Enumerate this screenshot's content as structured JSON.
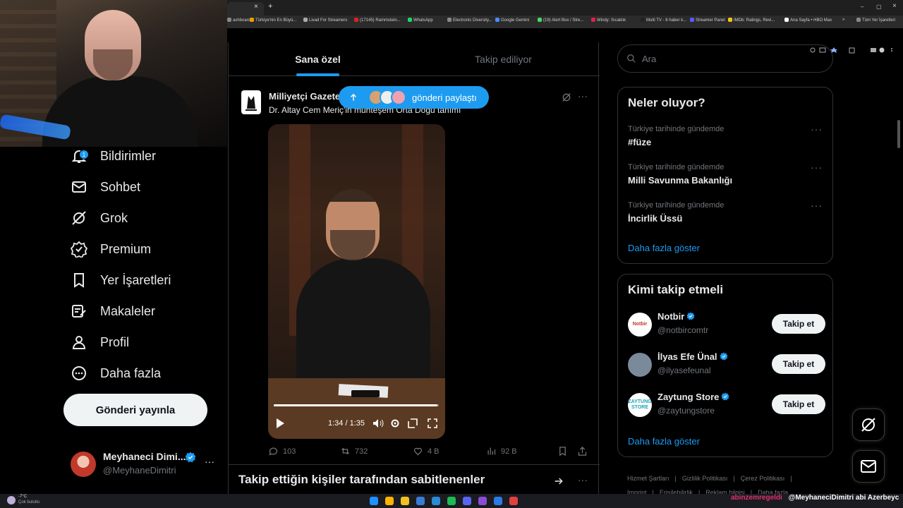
{
  "browser": {
    "bookmarks": [
      {
        "label": "ashboard",
        "color": "#888"
      },
      {
        "label": "Türkiye'nin En Büyü...",
        "color": "#e5a000"
      },
      {
        "label": "Livad For Streamers",
        "color": "#aaa"
      },
      {
        "label": "(17145) Rammstein...",
        "color": "#e02020"
      },
      {
        "label": "WhatsApp",
        "color": "#25d366"
      },
      {
        "label": "Electronic Diversity...",
        "color": "#888"
      },
      {
        "label": "Google Gemini",
        "color": "#4a8cff"
      },
      {
        "label": "(19) Alert Box / Stre...",
        "color": "#4cd964"
      },
      {
        "label": "Windy: Sıcaklık",
        "color": "#e02050"
      },
      {
        "label": "Multi TV - 6 haber k...",
        "color": "#222"
      },
      {
        "label": "Streamer Panel",
        "color": "#5a5aff"
      },
      {
        "label": "IMDb: Ratings, Revi...",
        "color": "#f5c518"
      },
      {
        "label": "Ana Sayfa • HBO Max",
        "color": "#fff"
      },
      {
        "label": "»",
        "color": ""
      },
      {
        "label": "Tüm Yer İşaretleri",
        "color": "#888"
      }
    ],
    "tab_close": "×",
    "new_tab": "+",
    "win_min": "–",
    "win_max": "▢",
    "win_close": "×"
  },
  "sidebar": {
    "notif_badge": "1",
    "items": [
      {
        "label": "Bildirimler",
        "icon": "bell-icon"
      },
      {
        "label": "Sohbet",
        "icon": "mail-icon"
      },
      {
        "label": "Grok",
        "icon": "grok-icon"
      },
      {
        "label": "Premium",
        "icon": "premium-icon"
      },
      {
        "label": "Yer İşaretleri",
        "icon": "bookmark-icon"
      },
      {
        "label": "Makaleler",
        "icon": "article-icon"
      },
      {
        "label": "Profil",
        "icon": "person-icon"
      },
      {
        "label": "Daha fazla",
        "icon": "more-circle-icon"
      }
    ],
    "post_button": "Gönderi yayınla",
    "profile": {
      "name": "Meyhaneci Dimi...",
      "handle": "@MeyhaneDimitri",
      "more": "···"
    }
  },
  "feed": {
    "tabs": [
      "Sana özel",
      "Takip ediliyor"
    ],
    "new_posts_pill": "gönderi paylaştı",
    "post": {
      "author": "Milliyetçi Gazete",
      "text": "Dr. Altay Cem Meriç'in muhteşem Orta Doğu tanımı",
      "video_time": "1:34 / 1:35",
      "video_progress": 0.99,
      "more": "···",
      "replies": "103",
      "reposts": "732",
      "likes": "4 B",
      "views": "92 B"
    },
    "pinned_section": "Takip ettiğin kişiler tarafından sabitlenenler",
    "pinned_more": "···"
  },
  "right": {
    "search_placeholder": "Ara",
    "trends_title": "Neler oluyor?",
    "trends": [
      {
        "context": "Türkiye tarihinde gündemde",
        "name": "#füze"
      },
      {
        "context": "Türkiye tarihinde gündemde",
        "name": "Milli Savunma Bakanlığı"
      },
      {
        "context": "Türkiye tarihinde gündemde",
        "name": "İncirlik Üssü"
      }
    ],
    "show_more": "Daha fazla göster",
    "who_to_follow_title": "Kimi takip etmeli",
    "follow": [
      {
        "name": "Notbir",
        "handle": "@notbircomtr",
        "button": "Takip et",
        "avatar_text": "Notbir"
      },
      {
        "name": "İlyas Efe Ünal",
        "handle": "@ilyasefeunal",
        "button": "Takip et",
        "avatar_text": ""
      },
      {
        "name": "Zaytung Store",
        "handle": "@zaytungstore",
        "button": "Takip et",
        "avatar_text": "ZAYTUNG STORE"
      }
    ],
    "show_more_2": "Daha fazla göster",
    "footer_line1": [
      "Hizmet Şartları",
      "|",
      "Gizlilik Politikası",
      "|",
      "Çerez Politikası",
      "|"
    ],
    "footer_line2": [
      "Imprint",
      "|",
      "Erişilebilirlik",
      "|",
      "Reklam bilgisi",
      "|",
      "Daha fazla ..."
    ]
  },
  "taskbar": {
    "weather_temp": "-7°C",
    "weather_desc": "Çok bulutlu",
    "chat_user": "abinzemregeldi",
    "chat_text": "@MeyhaneciDimitri abi Azerbeyc"
  },
  "colors": {
    "accent": "#1d9bf0",
    "bg": "#000000",
    "border": "#2f3336",
    "muted": "#71767b"
  }
}
